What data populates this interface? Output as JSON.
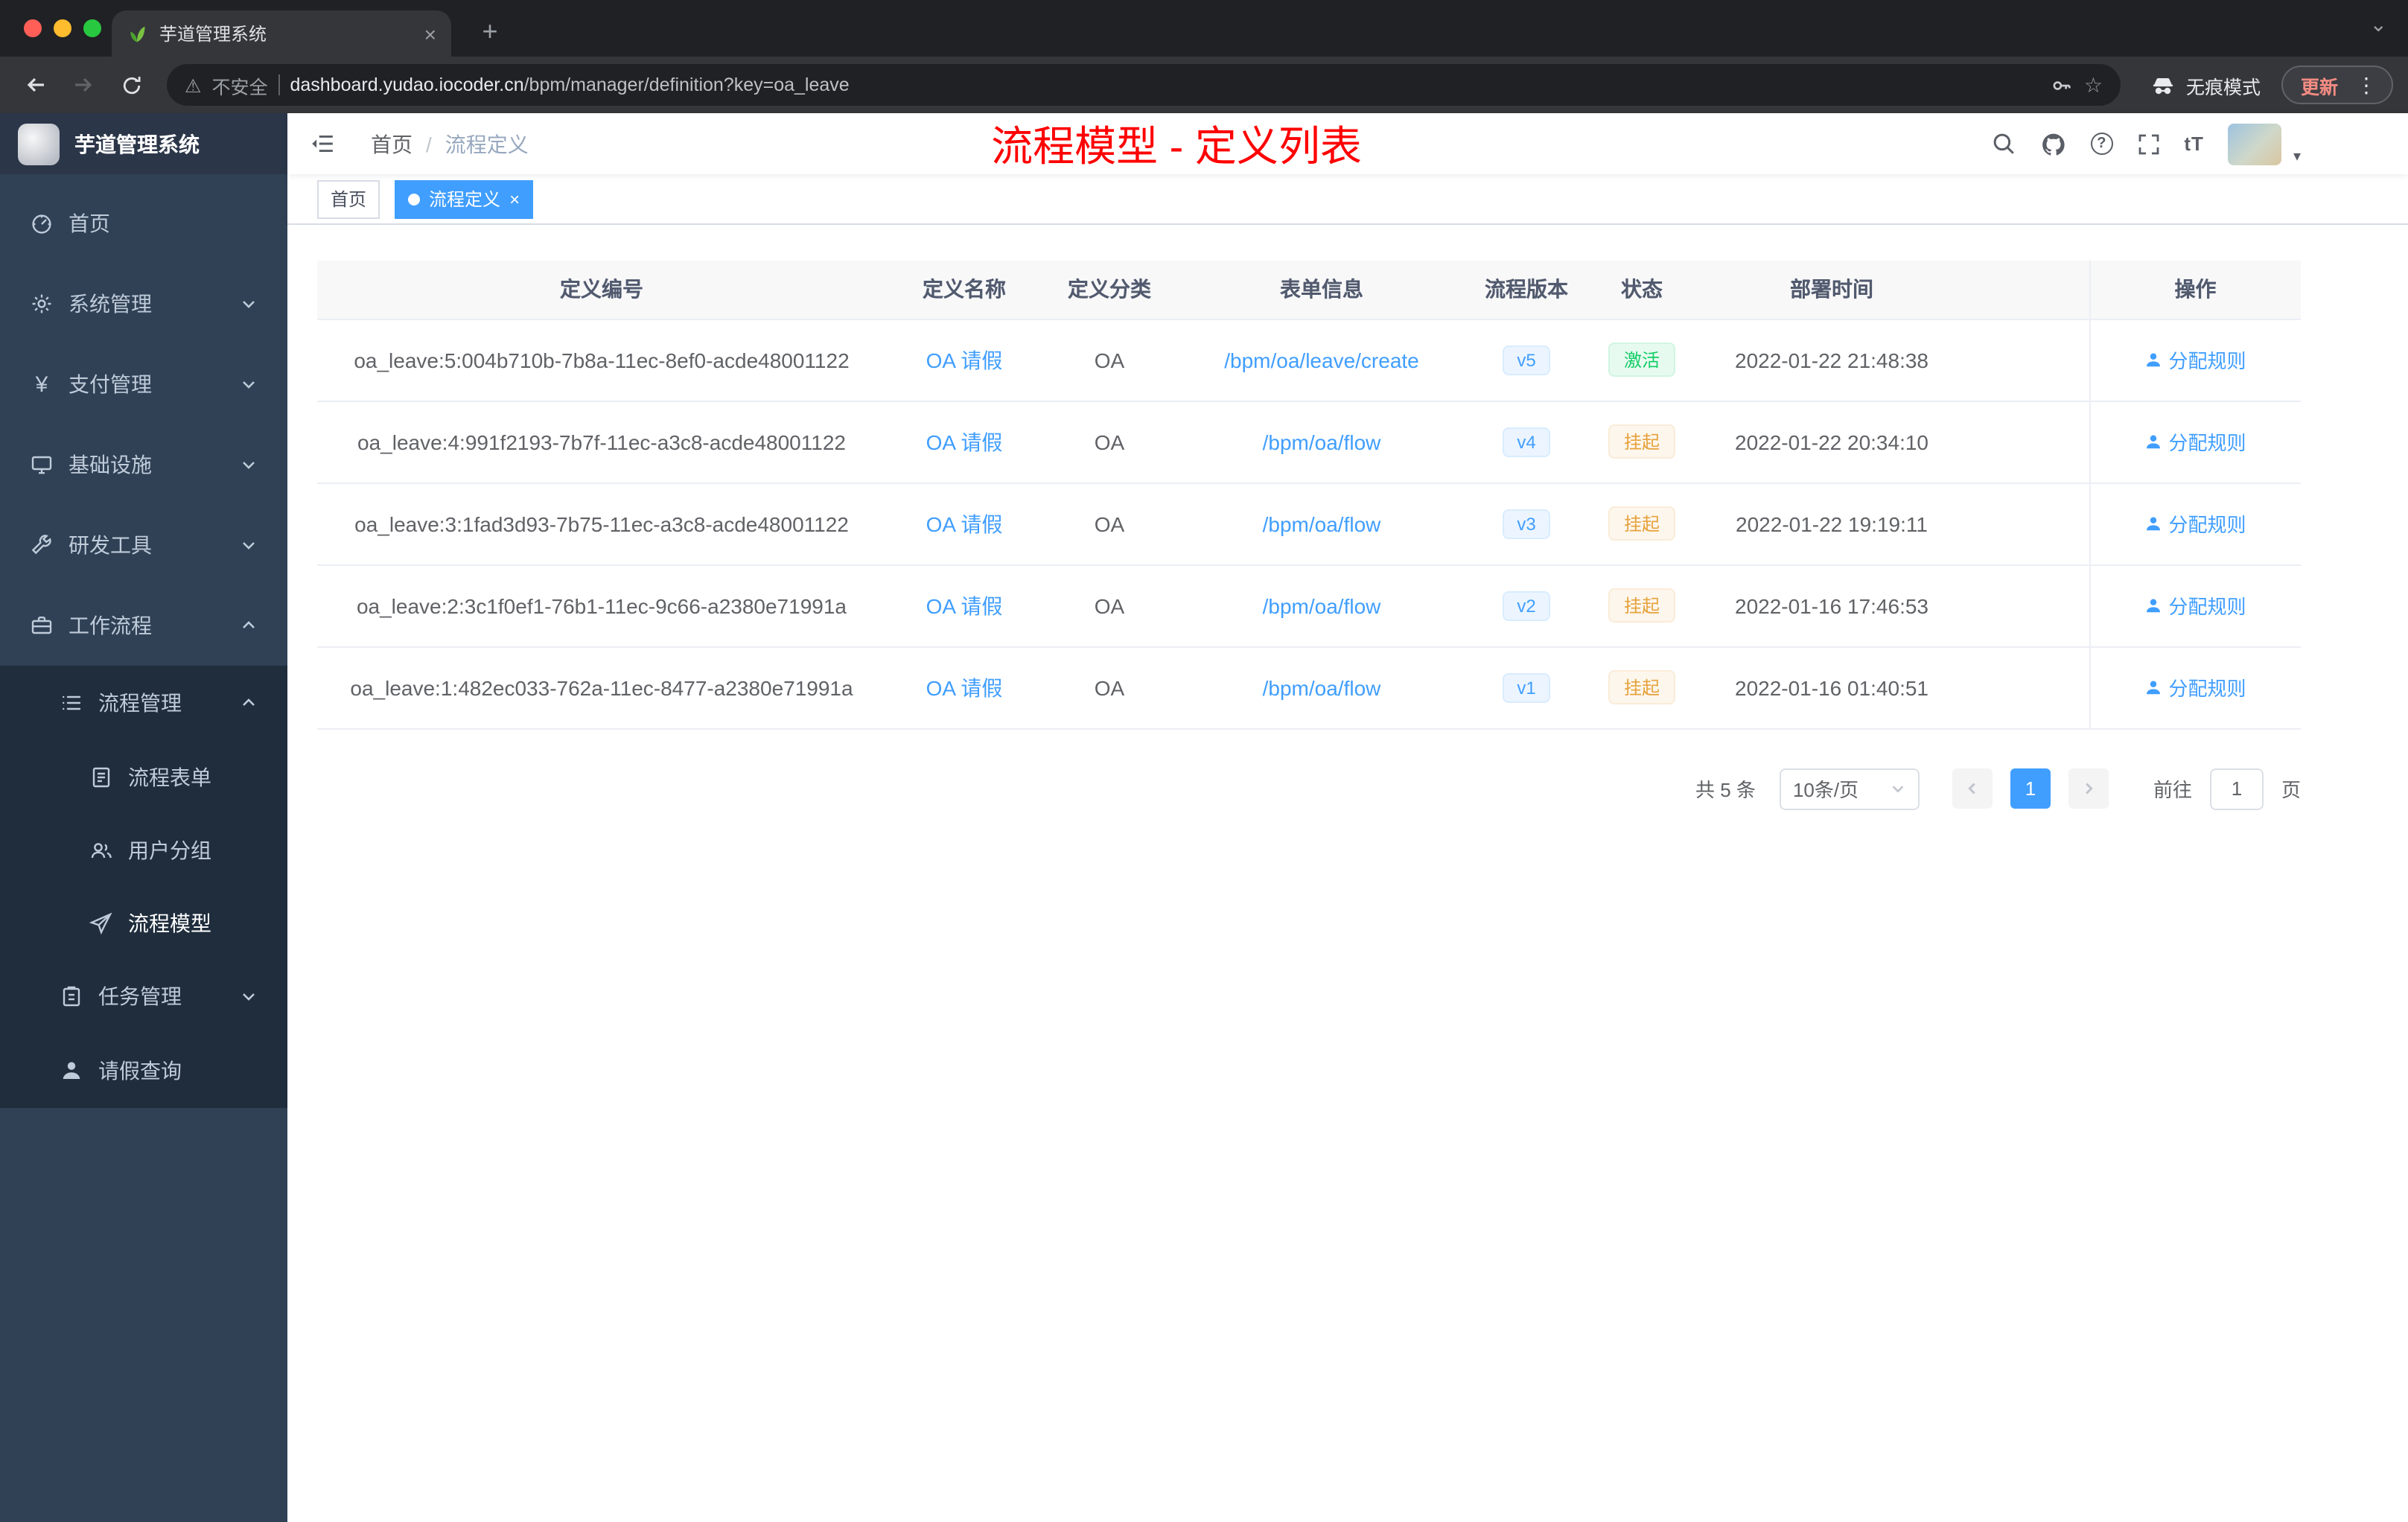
{
  "browser": {
    "tab_title": "芋道管理系统",
    "security_label": "不安全",
    "url_host": "dashboard.yudao.iocoder.cn",
    "url_path": "/bpm/manager/definition?key=oa_leave",
    "incognito_label": "无痕模式",
    "update_label": "更新"
  },
  "icons": {
    "close": "×",
    "plus": "+",
    "more": "⋮",
    "star": "☆",
    "warning": "⚠",
    "yen": "¥",
    "font_size": "tT",
    "question": "?",
    "caret": "▾",
    "tab_chevron": "⌄",
    "breadcrumb_sep": "/"
  },
  "sidebar": {
    "logo_title": "芋道管理系统",
    "items": [
      {
        "label": "首页"
      },
      {
        "label": "系统管理"
      },
      {
        "label": "支付管理"
      },
      {
        "label": "基础设施"
      },
      {
        "label": "研发工具"
      },
      {
        "label": "工作流程"
      },
      {
        "label": "流程管理"
      },
      {
        "label": "流程表单"
      },
      {
        "label": "用户分组"
      },
      {
        "label": "流程模型"
      },
      {
        "label": "任务管理"
      },
      {
        "label": "请假查询"
      }
    ]
  },
  "header": {
    "breadcrumb_home": "首页",
    "breadcrumb_current": "流程定义",
    "overlay_title": "流程模型 - 定义列表"
  },
  "tags": {
    "home": "首页",
    "current": "流程定义"
  },
  "table": {
    "columns": [
      "定义编号",
      "定义名称",
      "定义分类",
      "表单信息",
      "流程版本",
      "状态",
      "部署时间",
      "操作"
    ],
    "rows": [
      {
        "id": "oa_leave:5:004b710b-7b8a-11ec-8ef0-acde48001122",
        "name": "OA 请假",
        "category": "OA",
        "form": "/bpm/oa/leave/create",
        "version": "v5",
        "status": "激活",
        "status_type": "success",
        "time": "2022-01-22 21:48:38",
        "action": "分配规则"
      },
      {
        "id": "oa_leave:4:991f2193-7b7f-11ec-a3c8-acde48001122",
        "name": "OA 请假",
        "category": "OA",
        "form": "/bpm/oa/flow",
        "version": "v4",
        "status": "挂起",
        "status_type": "warning",
        "time": "2022-01-22 20:34:10",
        "action": "分配规则"
      },
      {
        "id": "oa_leave:3:1fad3d93-7b75-11ec-a3c8-acde48001122",
        "name": "OA 请假",
        "category": "OA",
        "form": "/bpm/oa/flow",
        "version": "v3",
        "status": "挂起",
        "status_type": "warning",
        "time": "2022-01-22 19:19:11",
        "action": "分配规则"
      },
      {
        "id": "oa_leave:2:3c1f0ef1-76b1-11ec-9c66-a2380e71991a",
        "name": "OA 请假",
        "category": "OA",
        "form": "/bpm/oa/flow",
        "version": "v2",
        "status": "挂起",
        "status_type": "warning",
        "time": "2022-01-16 17:46:53",
        "action": "分配规则"
      },
      {
        "id": "oa_leave:1:482ec033-762a-11ec-8477-a2380e71991a",
        "name": "OA 请假",
        "category": "OA",
        "form": "/bpm/oa/flow",
        "version": "v1",
        "status": "挂起",
        "status_type": "warning",
        "time": "2022-01-16 01:40:51",
        "action": "分配规则"
      }
    ]
  },
  "pagination": {
    "total": "共 5 条",
    "size": "10条/页",
    "page": "1",
    "goto_label": "前往",
    "goto_value": "1",
    "page_suffix": "页"
  },
  "colors": {
    "accent": "#409eff",
    "overlay_title_red": "#ff0000",
    "status_active_text": "#13ce66",
    "status_active_bg": "#e7faf0",
    "status_suspend_text": "#e6a23c",
    "status_suspend_bg": "#fdf6ec"
  }
}
